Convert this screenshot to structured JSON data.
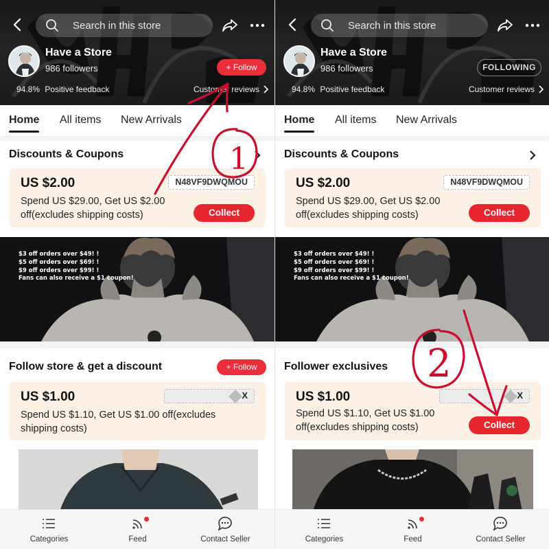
{
  "colors": {
    "accent": "#ea2e3a",
    "annotation": "#c8102e",
    "coupon_bg": "#fdf1e6"
  },
  "left": {
    "search": {
      "placeholder": "Search in this store"
    },
    "store": {
      "name": "Have a Store",
      "followers": "986 followers",
      "feedback_pct": "94.8%",
      "feedback_label": "Positive feedback",
      "reviews_label": "Customer reviews"
    },
    "follow_button": "+ Follow",
    "tabs": [
      "Home",
      "All items",
      "New Arrivals"
    ],
    "discounts": {
      "title": "Discounts & Coupons",
      "coupon": {
        "amount": "US $2.00",
        "code": "N48VF9DWQMOU",
        "desc_line1": "Spend US $29.00, Get US $2.00",
        "desc_line2": "off(excludes shipping costs)",
        "button": "Collect"
      }
    },
    "banner": {
      "lines": [
        "$3 off orders over $49! !",
        "$5 off orders over $69! !",
        "$9 off orders over $99! !",
        "Fans can also receive a $1 coupon!"
      ]
    },
    "follow_section": {
      "title": "Follow store & get a discount",
      "follow_button": "+ Follow",
      "coupon": {
        "amount": "US $1.00",
        "code_mask": "X",
        "desc_line1": "Spend US $1.10, Get US $1.00 off(excludes",
        "desc_line2": "shipping costs)"
      }
    },
    "nav": [
      "Categories",
      "Feed",
      "Contact Seller"
    ],
    "annotation_number": "1"
  },
  "right": {
    "search": {
      "placeholder": "Search in this store"
    },
    "store": {
      "name": "Have a Store",
      "followers": "986 followers",
      "feedback_pct": "94.8%",
      "feedback_label": "Positive feedback",
      "reviews_label": "Customer reviews"
    },
    "following_button": "FOLLOWING",
    "tabs": [
      "Home",
      "All items",
      "New Arrivals"
    ],
    "discounts": {
      "title": "Discounts & Coupons",
      "coupon": {
        "amount": "US $2.00",
        "code": "N48VF9DWQMOU",
        "desc_line1": "Spend US $29.00, Get US $2.00",
        "desc_line2": "off(excludes shipping costs)",
        "button": "Collect"
      }
    },
    "banner": {
      "lines": [
        "$3 off orders over $49! !",
        "$5 off orders over $69! !",
        "$9 off orders over $99! !",
        "Fans can also receive a $1 coupon!"
      ]
    },
    "exclusives": {
      "title": "Follower exclusives",
      "coupon": {
        "amount": "US $1.00",
        "code_mask": "X",
        "desc_line1": "Spend US $1.10, Get US $1.00",
        "desc_line2": "off(excludes shipping costs)",
        "button": "Collect"
      }
    },
    "nav": [
      "Categories",
      "Feed",
      "Contact Seller"
    ],
    "annotation_number": "2"
  }
}
